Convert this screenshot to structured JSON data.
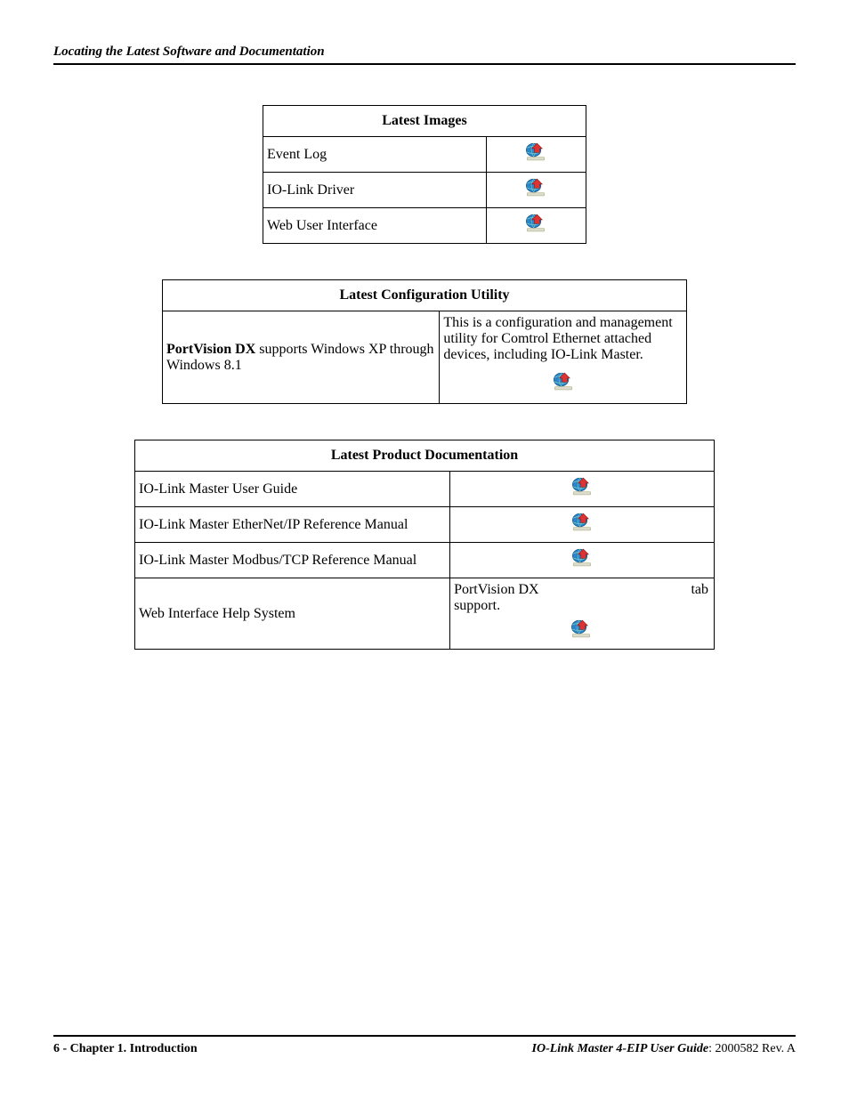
{
  "header": {
    "running_head": "Locating the Latest Software and Documentation"
  },
  "tables": {
    "images": {
      "caption": "Latest Images",
      "rows": [
        {
          "label": "Event Log"
        },
        {
          "label": "IO-Link Driver"
        },
        {
          "label": "Web User Interface"
        }
      ]
    },
    "config_utility": {
      "caption": "Latest Configuration Utility",
      "left_bold": "PortVision DX",
      "left_rest": " supports Windows XP through Windows 8.1",
      "right_desc": "This is a configuration and management utility for Comtrol Ethernet attached devices, including IO-Link Master."
    },
    "docs": {
      "caption": "Latest Product Documentation",
      "rows": [
        {
          "label": "IO-Link Master User Guide"
        },
        {
          "label": "IO-Link Master EtherNet/IP Reference Manual"
        },
        {
          "label": "IO-Link Master Modbus/TCP Reference Manual"
        }
      ],
      "webhelp": {
        "label": "Web Interface Help System",
        "note_left": "PortVision DX",
        "note_right": "tab",
        "note_line2": "support."
      }
    }
  },
  "footer": {
    "left": "6 - Chapter 1. Introduction",
    "right_title": "IO-Link Master 4-EIP User Guide",
    "right_suffix": ": 2000582 Rev. A"
  }
}
